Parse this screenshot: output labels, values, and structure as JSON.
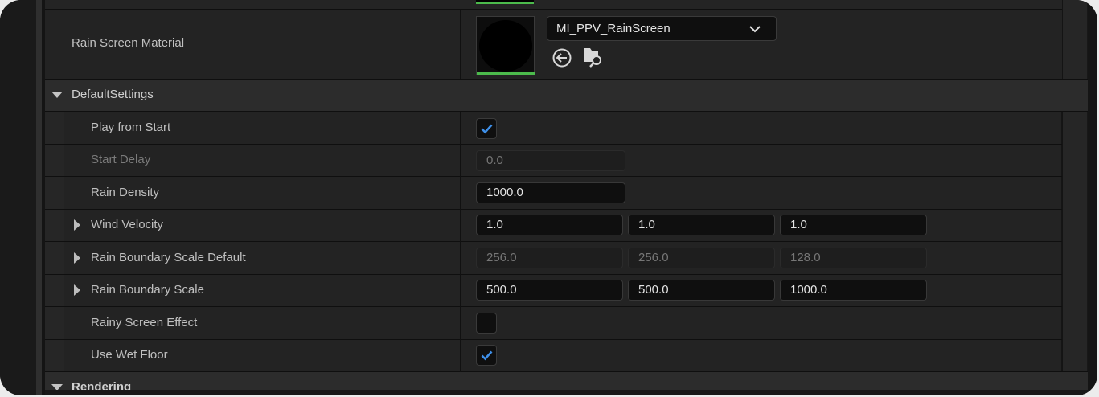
{
  "properties": {
    "rain_screen_material": {
      "label": "Rain Screen Material",
      "asset_value": "MI_PPV_RainScreen"
    },
    "default_settings": {
      "title": "DefaultSettings",
      "play_from_start": {
        "label": "Play from Start",
        "checked": true
      },
      "start_delay": {
        "label": "Start Delay",
        "value": "0.0"
      },
      "rain_density": {
        "label": "Rain Density",
        "value": "1000.0"
      },
      "wind_velocity": {
        "label": "Wind Velocity",
        "x": "1.0",
        "y": "1.0",
        "z": "1.0"
      },
      "rain_boundary_scale_default": {
        "label": "Rain Boundary Scale Default",
        "x": "256.0",
        "y": "256.0",
        "z": "128.0"
      },
      "rain_boundary_scale": {
        "label": "Rain Boundary Scale",
        "x": "500.0",
        "y": "500.0",
        "z": "1000.0"
      },
      "rainy_screen_effect": {
        "label": "Rainy Screen Effect",
        "checked": false
      },
      "use_wet_floor": {
        "label": "Use Wet Floor",
        "checked": true
      }
    },
    "rendering": {
      "title": "Rendering"
    }
  },
  "colors": {
    "panel": "#232323",
    "category_header": "#2c2c2c",
    "checkmark": "#3e8fe8",
    "asset_underline": "#4cbb4c",
    "field_bg": "#0f0f0f",
    "readonly_text": "#767676"
  }
}
